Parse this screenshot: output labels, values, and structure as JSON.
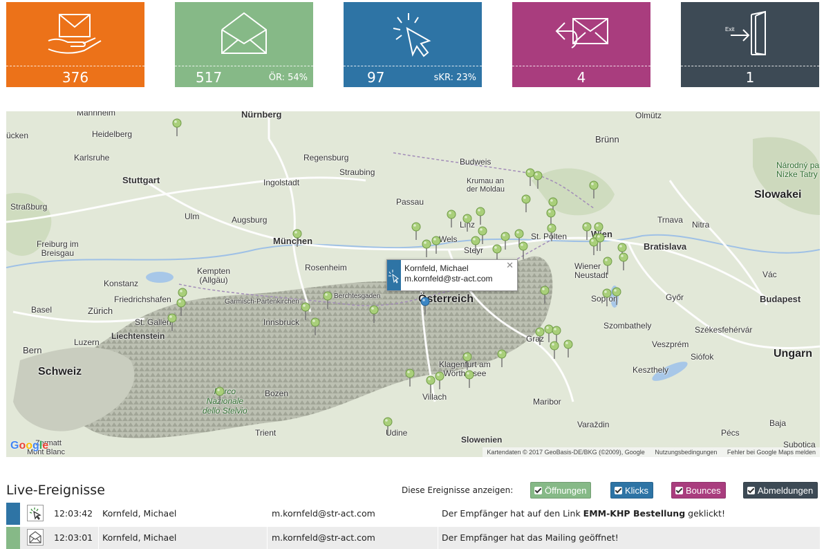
{
  "tiles": [
    {
      "name": "sent",
      "icon": "envelope-hand-icon",
      "count": "376",
      "rate": "",
      "color": "#ec7219"
    },
    {
      "name": "opened",
      "icon": "open-envelope-icon",
      "count": "517",
      "rate": "ÖR: 54%",
      "color": "#86b987"
    },
    {
      "name": "clicks",
      "icon": "cursor-click-icon",
      "count": "97",
      "rate": "sKR: 23%",
      "color": "#2e74a5"
    },
    {
      "name": "bounces",
      "icon": "bounce-envelope-icon",
      "count": "4",
      "rate": "",
      "color": "#a93d7e"
    },
    {
      "name": "unsubscribes",
      "icon": "exit-door-icon",
      "count": "1",
      "rate": "",
      "color": "#3d4a55"
    }
  ],
  "exit_icon_text": "Exit",
  "map": {
    "labels": {
      "nuernberg": "Nürnberg",
      "mannheim": "Mannheim",
      "heidelberg": "Heidelberg",
      "ucken": "ücken",
      "karlsruhe": "Karlsruhe",
      "stuttgart": "Stuttgart",
      "regensburg": "Regensburg",
      "straubing": "Straubing",
      "ingolstadt": "Ingolstadt",
      "strassburg": "Straßburg",
      "passau": "Passau",
      "ulm": "Ulm",
      "augsburg": "Augsburg",
      "muenchen": "München",
      "freiburg": "Freiburg im\nBreisgau",
      "kempten": "Kempten\n(Allgäu)",
      "rosenheim": "Rosenheim",
      "konstanz": "Konstanz",
      "friedrichshafen": "Friedrichshafen",
      "basel": "Basel",
      "zuerich": "Zürich",
      "stgallen": "St. Gallen",
      "liechtenstein": "Liechtenstein",
      "bern": "Bern",
      "luzern": "Luzern",
      "schweiz": "Schweiz",
      "garmisch": "Garmisch-Partenkirchen",
      "berchtesgaden": "Berchtesgaden",
      "innsbruck": "Innsbruck",
      "oesterreich": "Österreich",
      "wels": "Wels",
      "linz": "Linz",
      "steyr": "Steyr",
      "stpoelten": "St. Pölten",
      "wien": "Wien",
      "wienerneustadt": "Wiener\nNeustadt",
      "bratislava": "Bratislava",
      "budweis": "Budweis",
      "krumau": "Krumau an\nder Moldau",
      "bruenn": "Brünn",
      "olmuetz": "Olmütz",
      "slowakei": "Slowakei",
      "narodny": "Národný park\nNízke Tatry",
      "trnava": "Trnava",
      "nitra": "Nitra",
      "gyoer": "Győr",
      "budapest": "Budapest",
      "sopron": "Sopron",
      "szombathely": "Szombathely",
      "szekesfehervar": "Székesfehérvár",
      "veszprem": "Veszprém",
      "siofok": "Siófok",
      "ungarn": "Ungarn",
      "keszthely": "Keszthely",
      "graz": "Graz",
      "klagenfurt": "Klagenfurt am\nWörthersee",
      "villach": "Villach",
      "maribor": "Maribor",
      "bozen": "Bozen",
      "parco": "Parco\nNazionale\ndello Stelvio",
      "trient": "Trient",
      "udine": "Udine",
      "slowenien": "Slowenien",
      "varazdin": "Varaždin",
      "baja": "Baja",
      "pecs": "Pécs",
      "subotica": "Subotica",
      "vac": "Vác",
      "zermatt": "Zermatt",
      "montblanc": "Mont Blanc"
    },
    "info_window": {
      "name": "Kornfeld, Michael",
      "email": "m.kornfeld@str-act.com"
    },
    "logo": "Google",
    "attribution": "Kartendaten © 2017 GeoBasis-DE/BKG (©2009), Google",
    "terms": "Nutzungsbedingungen",
    "report": "Fehler bei Google Maps melden"
  },
  "live": {
    "title": "Live-Ereignisse",
    "filter_label": "Diese Ereignisse anzeigen:",
    "filters": [
      {
        "label": "Öffnungen",
        "color": "#86b987"
      },
      {
        "label": "Klicks",
        "color": "#2e74a5"
      },
      {
        "label": "Bounces",
        "color": "#a93d7e"
      },
      {
        "label": "Abmeldungen",
        "color": "#3d4a55"
      }
    ],
    "events": [
      {
        "time": "12:03:42",
        "name": "Kornfeld, Michael",
        "email": "m.kornfeld@str-act.com",
        "msg_prefix": "Der Empfänger hat auf den Link ",
        "msg_bold": "EMM-KHP Bestellung",
        "msg_suffix": " geklickt!",
        "color": "#2e74a5",
        "icon": "click-event-icon"
      },
      {
        "time": "12:03:01",
        "name": "Kornfeld, Michael",
        "email": "m.kornfeld@str-act.com",
        "msg_prefix": "Der Empfänger hat das Mailing geöffnet!",
        "msg_bold": "",
        "msg_suffix": "",
        "color": "#86b987",
        "icon": "open-event-icon"
      }
    ]
  }
}
